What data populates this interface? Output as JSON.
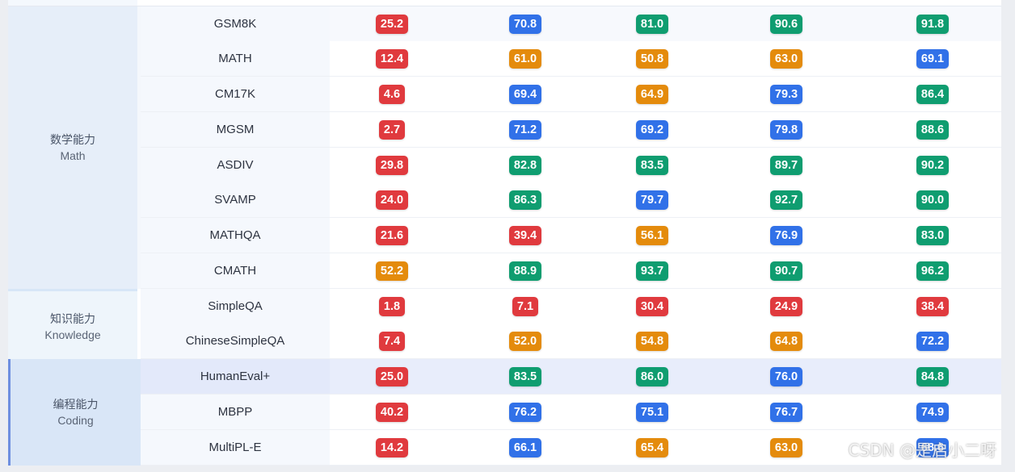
{
  "categories": {
    "math": {
      "zh": "数学能力",
      "en": "Math"
    },
    "knowledge": {
      "zh": "知识能力",
      "en": "Knowledge"
    },
    "coding": {
      "zh": "编程能力",
      "en": "Coding"
    }
  },
  "colors": {
    "red": "#e03a3e",
    "blue": "#3171e8",
    "green": "#0f9d70",
    "orange": "#e48b0c"
  },
  "rows": [
    {
      "benchmark": "GSM8K",
      "scores": [
        {
          "v": "25.2",
          "c": "red"
        },
        {
          "v": "70.8",
          "c": "blue"
        },
        {
          "v": "81.0",
          "c": "green"
        },
        {
          "v": "90.6",
          "c": "green"
        },
        {
          "v": "91.8",
          "c": "green"
        }
      ]
    },
    {
      "benchmark": "MATH",
      "scores": [
        {
          "v": "12.4",
          "c": "red"
        },
        {
          "v": "61.0",
          "c": "orange"
        },
        {
          "v": "50.8",
          "c": "orange"
        },
        {
          "v": "63.0",
          "c": "orange"
        },
        {
          "v": "69.1",
          "c": "blue"
        }
      ]
    },
    {
      "benchmark": "CM17K",
      "scores": [
        {
          "v": "4.6",
          "c": "red"
        },
        {
          "v": "69.4",
          "c": "blue"
        },
        {
          "v": "64.9",
          "c": "orange"
        },
        {
          "v": "79.3",
          "c": "blue"
        },
        {
          "v": "86.4",
          "c": "green"
        }
      ]
    },
    {
      "benchmark": "MGSM",
      "scores": [
        {
          "v": "2.7",
          "c": "red"
        },
        {
          "v": "71.2",
          "c": "blue"
        },
        {
          "v": "69.2",
          "c": "blue"
        },
        {
          "v": "79.8",
          "c": "blue"
        },
        {
          "v": "88.6",
          "c": "green"
        }
      ]
    },
    {
      "benchmark": "ASDIV",
      "scores": [
        {
          "v": "29.8",
          "c": "red"
        },
        {
          "v": "82.8",
          "c": "green"
        },
        {
          "v": "83.5",
          "c": "green"
        },
        {
          "v": "89.7",
          "c": "green"
        },
        {
          "v": "90.2",
          "c": "green"
        }
      ]
    },
    {
      "benchmark": "SVAMP",
      "scores": [
        {
          "v": "24.0",
          "c": "red"
        },
        {
          "v": "86.3",
          "c": "green"
        },
        {
          "v": "79.7",
          "c": "blue"
        },
        {
          "v": "92.7",
          "c": "green"
        },
        {
          "v": "90.0",
          "c": "green"
        }
      ]
    },
    {
      "benchmark": "MATHQA",
      "scores": [
        {
          "v": "21.6",
          "c": "red"
        },
        {
          "v": "39.4",
          "c": "red"
        },
        {
          "v": "56.1",
          "c": "orange"
        },
        {
          "v": "76.9",
          "c": "blue"
        },
        {
          "v": "83.0",
          "c": "green"
        }
      ]
    },
    {
      "benchmark": "CMATH",
      "scores": [
        {
          "v": "52.2",
          "c": "orange"
        },
        {
          "v": "88.9",
          "c": "green"
        },
        {
          "v": "93.7",
          "c": "green"
        },
        {
          "v": "90.7",
          "c": "green"
        },
        {
          "v": "96.2",
          "c": "green"
        }
      ]
    },
    {
      "benchmark": "SimpleQA",
      "scores": [
        {
          "v": "1.8",
          "c": "red"
        },
        {
          "v": "7.1",
          "c": "red"
        },
        {
          "v": "30.4",
          "c": "red"
        },
        {
          "v": "24.9",
          "c": "red"
        },
        {
          "v": "38.4",
          "c": "red"
        }
      ]
    },
    {
      "benchmark": "ChineseSimpleQA",
      "scores": [
        {
          "v": "7.4",
          "c": "red"
        },
        {
          "v": "52.0",
          "c": "orange"
        },
        {
          "v": "54.8",
          "c": "orange"
        },
        {
          "v": "64.8",
          "c": "orange"
        },
        {
          "v": "72.2",
          "c": "blue"
        }
      ]
    },
    {
      "benchmark": "HumanEval+",
      "scores": [
        {
          "v": "25.0",
          "c": "red"
        },
        {
          "v": "83.5",
          "c": "green"
        },
        {
          "v": "86.0",
          "c": "green"
        },
        {
          "v": "76.0",
          "c": "blue"
        },
        {
          "v": "84.8",
          "c": "green"
        }
      ]
    },
    {
      "benchmark": "MBPP",
      "scores": [
        {
          "v": "40.2",
          "c": "red"
        },
        {
          "v": "76.2",
          "c": "blue"
        },
        {
          "v": "75.1",
          "c": "blue"
        },
        {
          "v": "76.7",
          "c": "blue"
        },
        {
          "v": "74.9",
          "c": "blue"
        }
      ]
    },
    {
      "benchmark": "MultiPL-E",
      "scores": [
        {
          "v": "14.2",
          "c": "red"
        },
        {
          "v": "66.1",
          "c": "blue"
        },
        {
          "v": "65.4",
          "c": "orange"
        },
        {
          "v": "63.0",
          "c": "orange"
        },
        {
          "v": "68.6",
          "c": "blue"
        }
      ]
    }
  ],
  "watermark": "CSDN @是启小二呀"
}
